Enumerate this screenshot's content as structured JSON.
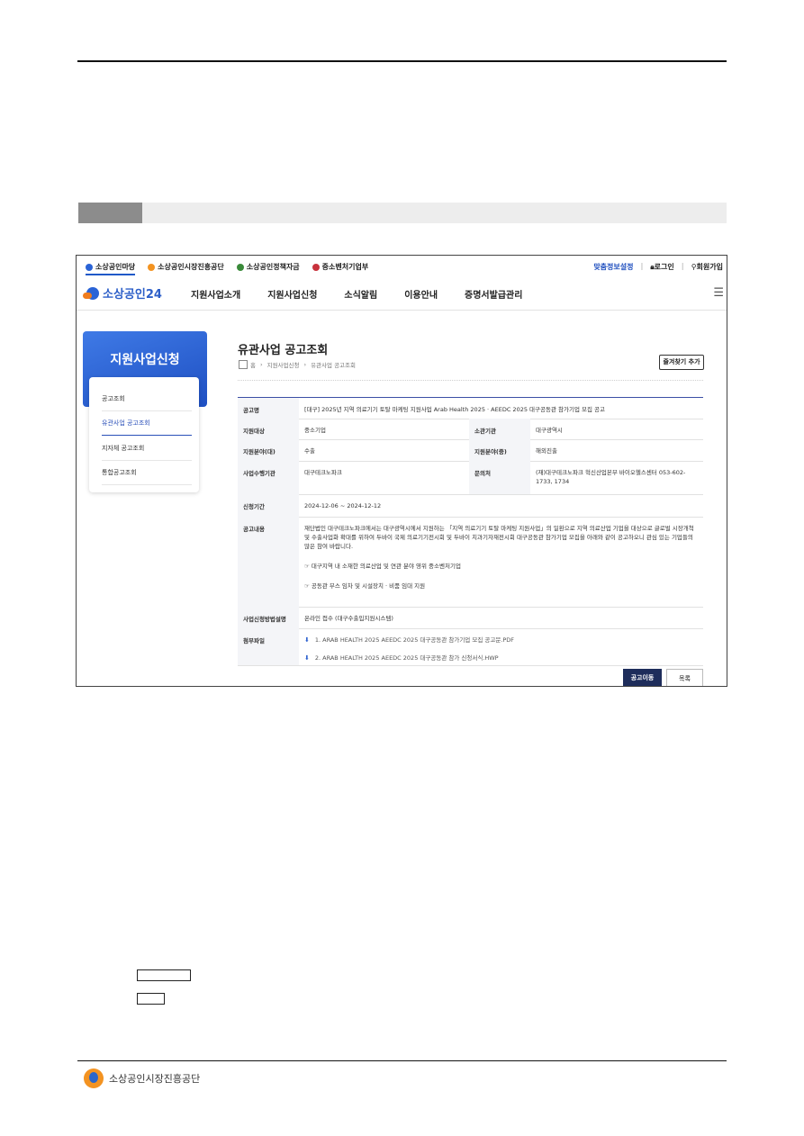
{
  "topbar": {
    "links": [
      "소상공인마당",
      "소상공인시장진흥공단",
      "소상공인정책자금",
      "중소벤처기업부"
    ],
    "custom_settings": "맞춤정보설정",
    "login": "로그인",
    "signup": "회원가입"
  },
  "gnb": {
    "logo_text": "소상공인24",
    "menu": [
      "지원사업소개",
      "지원사업신청",
      "소식알림",
      "이용안내",
      "증명서발급관리"
    ]
  },
  "side": {
    "banner_title": "지원사업신청",
    "items": [
      "공고조회",
      "유관사업 공고조회",
      "지자체 공고조회",
      "통합공고조회"
    ]
  },
  "main": {
    "title": "유관사업 공고조회",
    "breadcrumb": [
      "홈",
      "지원사업신청",
      "유관사업 공고조회"
    ],
    "favorite_button": "즐겨찾기 추가",
    "table": {
      "notice_name_label": "공고명",
      "notice_name": "[대구] 2025년 지역 의료기기 토탈 마케팅 지원사업 Arab Health 2025 · AEEDC 2025 대구공동관 참가기업 모집 공고",
      "target_label": "지원대상",
      "target": "중소기업",
      "agency_label": "소관기관",
      "agency": "대구광역시",
      "field_major_label": "지원분야(대)",
      "field_major": "수출",
      "field_minor_label": "지원분야(중)",
      "field_minor": "해외진출",
      "executor_label": "사업수행기관",
      "executor": "대구테크노파크",
      "contact_label": "문의처",
      "contact": "(재)대구테크노파크 혁신산업본부 바이오헬스센터 053-602-1733, 1734",
      "period_label": "신청기간",
      "period": "2024-12-06 ~ 2024-12-12",
      "content_label": "공고내용",
      "content_para": "재단법인 대구테크노파크에서는 대구광역시에서 지원하는 「지역 의료기기 토탈 마케팅 지원사업」의 일환으로 지역 의료산업 기업을 대상으로 글로벌 시장개척 및 수출사업화 확대를 위하여 두바이 국제 의료기기전시회 및 두바이 치과기자재전시회 대구공동관 참가기업 모집을 아래와 같이 공고하오니 관심 있는 기업들의 많은 참여 바랍니다.",
      "content_bullet1": "☞ 대구지역 내 소재한 의료산업 및 연관 분야 영위 중소벤처기업",
      "content_bullet2": "☞ 공동관 부스 임차 및 시설장치 · 비품 임대 지원",
      "apply_method_label": "사업신청방법설명",
      "apply_method": "온라인 접수 (대구수출입지원시스템)",
      "attachment_label": "첨부파일",
      "attachments": [
        "1. ARAB HEALTH 2025 AEEDC 2025 대구공동관 참가기업 모집 공고문.PDF",
        "2. ARAB HEALTH 2025 AEEDC 2025 대구공동관 참가 신청서식.HWP"
      ]
    },
    "go_button": "공고이동",
    "list_button": "목록"
  },
  "footer": {
    "org_name": "소상공인시장진흥공단"
  },
  "colors": {
    "brand_blue": "#2d5fc8",
    "brand_orange": "#f07d1e",
    "dark_button": "#1e2d5b"
  }
}
